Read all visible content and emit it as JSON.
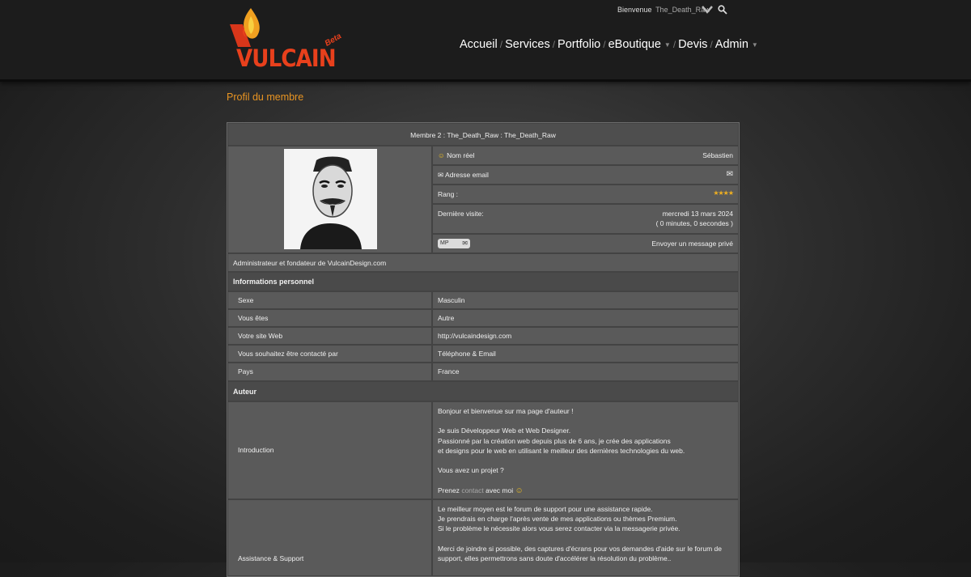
{
  "header": {
    "logo_text": "VULCAIN",
    "logo_badge": "Beta",
    "welcome_label": "Bienvenue",
    "username": "The_Death_Raw",
    "nav": [
      {
        "label": "Accueil",
        "dropdown": false
      },
      {
        "label": "Services",
        "dropdown": false
      },
      {
        "label": "Portfolio",
        "dropdown": false
      },
      {
        "label": "eBoutique",
        "dropdown": true
      },
      {
        "label": "Devis",
        "dropdown": false
      },
      {
        "label": "Admin",
        "dropdown": true
      }
    ],
    "accent_color": "#e8401c"
  },
  "page_title": "Profil du membre",
  "profile": {
    "title": "Membre 2 : The_Death_Raw : The_Death_Raw",
    "real_name_label": "Nom réel",
    "real_name": "Sébastien",
    "email_label": "Adresse email",
    "rank_label": "Rang :",
    "rank_stars": "★★★★",
    "last_visit_label": "Dernière visite:",
    "last_visit_date": "mercredi 13 mars 2024",
    "last_visit_ago": "( 0 minutes, 0 secondes  )",
    "pm_label": "MP",
    "pm_text": "Envoyer un message privé",
    "signature": "Administrateur et fondateur de VulcainDesign.com"
  },
  "personal": {
    "heading": "Informations personnel",
    "rows": [
      {
        "label": "Sexe",
        "value": "Masculin"
      },
      {
        "label": "Vous êtes",
        "value": "Autre"
      },
      {
        "label": "Votre site Web",
        "value": "http://vulcaindesign.com"
      },
      {
        "label": "Vous souhaitez être contacté par",
        "value": "Téléphone & Email"
      },
      {
        "label": "Pays",
        "value": "France"
      }
    ]
  },
  "author": {
    "heading": "Auteur",
    "intro_label": "Introduction",
    "intro_lines": [
      "Bonjour et bienvenue sur ma page d'auteur !",
      "",
      "Je suis Développeur Web et Web Designer.",
      "Passionné par la création web depuis plus de 6 ans, je crée des applications",
      "et designs pour le web en utilisant le meilleur des dernières technologies du web.",
      "",
      "Vous avez un projet ?",
      ""
    ],
    "intro_cta_before": "Prenez",
    "intro_cta_link": "contact",
    "intro_cta_after": "avec moi",
    "support_label": "Assistance & Support",
    "support_lines": [
      "Le meilleur moyen est le forum de support pour une assistance rapide.",
      "Je prendrais en charge l'après vente de mes applications ou thèmes Premium.",
      "Si le problème le nécessite alors vous serez contacter via la messagerie privée.",
      "",
      "Merci de joindre si possible, des captures d'écrans pour vos demandes d'aide sur le forum de",
      "support, elles permettrons sans doute d'accélérer la résolution du problème.."
    ]
  }
}
